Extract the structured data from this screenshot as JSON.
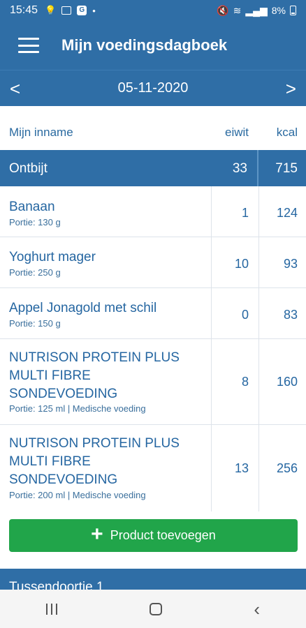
{
  "status_bar": {
    "time": "15:45",
    "battery": "8%"
  },
  "app_bar": {
    "title": "Mijn voedingsdagboek"
  },
  "date_bar": {
    "prev": "<",
    "date": "05-11-2020",
    "next": ">"
  },
  "columns": {
    "name": "Mijn inname",
    "eiwit": "eiwit",
    "kcal": "kcal"
  },
  "meal": {
    "name": "Ontbijt",
    "eiwit": "33",
    "kcal": "715"
  },
  "items": [
    {
      "name": "Banaan",
      "portion": "Portie: 130 g",
      "eiwit": "1",
      "kcal": "124"
    },
    {
      "name": "Yoghurt mager",
      "portion": "Portie: 250 g",
      "eiwit": "10",
      "kcal": "93"
    },
    {
      "name": "Appel Jonagold met schil",
      "portion": "Portie: 150 g",
      "eiwit": "0",
      "kcal": "83"
    },
    {
      "name": "NUTRISON PROTEIN PLUS MULTI FIBRE SONDEVOEDING",
      "portion": "Portie: 125 ml | Medische voeding",
      "eiwit": "8",
      "kcal": "160"
    },
    {
      "name": "NUTRISON PROTEIN PLUS MULTI FIBRE SONDEVOEDING",
      "portion": "Portie: 200 ml | Medische voeding",
      "eiwit": "13",
      "kcal": "256"
    }
  ],
  "add_button": {
    "label": "Product toevoegen"
  },
  "next_meal": {
    "name": "Tussendoortje 1"
  },
  "colors": {
    "primary": "#2f6ea6",
    "accent": "#21a54a"
  }
}
